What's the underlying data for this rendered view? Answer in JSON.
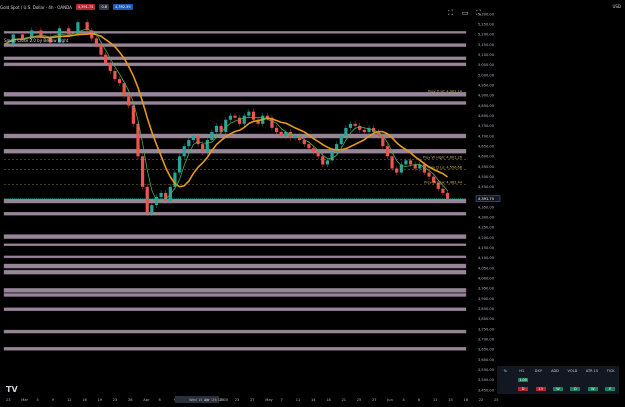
{
  "header": {
    "title": "Gold Spot / U.S. Dollar · 4h · OANDA",
    "badges": [
      {
        "text": "4,391.75",
        "color": "#b22833"
      },
      {
        "text": "0.8",
        "color": "#333a45"
      },
      {
        "text": "4,392.55",
        "color": "#1e5ab4"
      }
    ]
  },
  "indicator_label": "Smart Close 2.0 by Bellow Right",
  "currency": "USD",
  "logo": "TV",
  "colors": {
    "zone_fill": "#c8b4c8",
    "zone_border": "#8a6a8a",
    "ma_orange": "#e39a1e",
    "ma_green": "#4caf50",
    "candle_up": "#26a69a",
    "candle_down": "#ef5350",
    "price_marker": "#00bcd4"
  },
  "watchlist": {
    "headers": [
      "%",
      "H1",
      "DXY",
      "ADD",
      "VOLD",
      "ATR 15",
      "TICK"
    ],
    "row1": [
      "",
      "1.00",
      "",
      "",
      "",
      "",
      ""
    ],
    "row2": [
      "",
      "D",
      "13",
      "W",
      "D",
      "W",
      "E"
    ]
  },
  "chart_data": {
    "type": "candlestick",
    "title": "Gold Spot / U.S. Dollar",
    "timeframe": "4h",
    "y_ticks": [
      5300,
      5250,
      5200,
      5150,
      5100,
      5050,
      5000,
      4950,
      4900,
      4850,
      4800,
      4750,
      4700,
      4650,
      4600,
      4550,
      4500,
      4450,
      4400,
      4350,
      4300,
      4250,
      4200,
      4150,
      4100,
      4050,
      4000,
      3950,
      3900,
      3850,
      3800,
      3750,
      3700,
      3650,
      3600,
      3550,
      3500,
      3450
    ],
    "ylim": [
      3440,
      5330
    ],
    "x_ticks": [
      "23",
      "Mar",
      "5",
      "9",
      "12",
      "16",
      "19",
      "23",
      "26",
      "Apr",
      "6",
      "9",
      "Wed 15 Apr '26  10:00",
      "16",
      "20",
      "23",
      "27",
      "May",
      "7",
      "11",
      "14",
      "18",
      "21",
      "25",
      "27",
      "Jun",
      "4",
      "8",
      "11",
      "15",
      "18",
      "22",
      "25"
    ],
    "x_range": [
      0,
      100
    ],
    "candles_close": [
      [
        0,
        5150
      ],
      [
        2,
        5200
      ],
      [
        4,
        5180
      ],
      [
        6,
        5220
      ],
      [
        8,
        5190
      ],
      [
        10,
        5160
      ],
      [
        12,
        5230
      ],
      [
        14,
        5200
      ],
      [
        16,
        5260
      ],
      [
        18,
        5220
      ],
      [
        19,
        5180
      ],
      [
        20,
        5150
      ],
      [
        21,
        5100
      ],
      [
        22,
        5060
      ],
      [
        23,
        5020
      ],
      [
        24,
        4980
      ],
      [
        25,
        4960
      ],
      [
        26,
        4900
      ],
      [
        27,
        4850
      ],
      [
        28,
        4760
      ],
      [
        29,
        4600
      ],
      [
        30,
        4450
      ],
      [
        31,
        4320
      ],
      [
        32,
        4360
      ],
      [
        33,
        4400
      ],
      [
        34,
        4420
      ],
      [
        35,
        4380
      ],
      [
        36,
        4450
      ],
      [
        37,
        4520
      ],
      [
        38,
        4600
      ],
      [
        39,
        4650
      ],
      [
        40,
        4680
      ],
      [
        41,
        4700
      ],
      [
        42,
        4660
      ],
      [
        43,
        4620
      ],
      [
        44,
        4680
      ],
      [
        45,
        4720
      ],
      [
        46,
        4750
      ],
      [
        47,
        4720
      ],
      [
        48,
        4780
      ],
      [
        49,
        4800
      ],
      [
        50,
        4790
      ],
      [
        51,
        4760
      ],
      [
        52,
        4800
      ],
      [
        53,
        4820
      ],
      [
        54,
        4780
      ],
      [
        55,
        4760
      ],
      [
        56,
        4800
      ],
      [
        57,
        4790
      ],
      [
        58,
        4740
      ],
      [
        59,
        4720
      ],
      [
        60,
        4700
      ],
      [
        61,
        4720
      ],
      [
        62,
        4690
      ],
      [
        63,
        4700
      ],
      [
        64,
        4680
      ],
      [
        65,
        4660
      ],
      [
        66,
        4640
      ],
      [
        67,
        4620
      ],
      [
        68,
        4600
      ],
      [
        69,
        4560
      ],
      [
        70,
        4580
      ],
      [
        71,
        4620
      ],
      [
        72,
        4660
      ],
      [
        73,
        4700
      ],
      [
        74,
        4740
      ],
      [
        75,
        4760
      ],
      [
        76,
        4750
      ],
      [
        77,
        4730
      ],
      [
        78,
        4720
      ],
      [
        79,
        4740
      ],
      [
        80,
        4720
      ],
      [
        81,
        4700
      ],
      [
        82,
        4650
      ],
      [
        83,
        4600
      ],
      [
        84,
        4540
      ],
      [
        85,
        4520
      ],
      [
        86,
        4560
      ],
      [
        87,
        4580
      ],
      [
        88,
        4560
      ],
      [
        89,
        4540
      ],
      [
        90,
        4560
      ],
      [
        91,
        4520
      ],
      [
        92,
        4500
      ],
      [
        93,
        4470
      ],
      [
        94,
        4440
      ],
      [
        95,
        4420
      ],
      [
        96,
        4391
      ]
    ],
    "support_resistance_zones": [
      [
        5215,
        5205
      ],
      [
        5155,
        5140
      ],
      [
        5090,
        5075
      ],
      [
        5060,
        5045
      ],
      [
        4915,
        4895
      ],
      [
        4870,
        4855
      ],
      [
        4710,
        4690
      ],
      [
        4635,
        4615
      ],
      [
        4390,
        4370
      ],
      [
        4325,
        4310
      ],
      [
        4215,
        4195
      ],
      [
        4170,
        4160
      ],
      [
        4110,
        4100
      ],
      [
        4070,
        4050
      ],
      [
        4040,
        4020
      ],
      [
        3950,
        3930
      ],
      [
        3925,
        3910
      ],
      [
        3855,
        3840
      ],
      [
        3745,
        3730
      ],
      [
        3660,
        3645
      ]
    ],
    "price_labels": [
      {
        "text": "Prev D Hi: 4,901.14",
        "y": 4910
      },
      {
        "text": "Prev W High: 4,601.26",
        "y": 4585
      },
      {
        "text": "Prev D Lo: 4,556.68",
        "y": 4535
      },
      {
        "text": "Prev W Low: 4,462.44",
        "y": 4462
      }
    ],
    "current_price": 4391.75,
    "grid": false
  }
}
